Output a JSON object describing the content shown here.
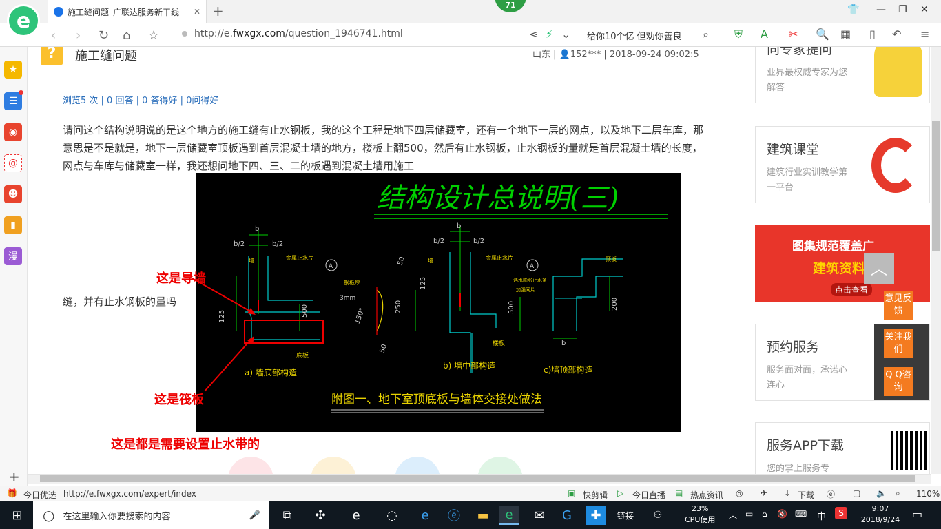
{
  "browser": {
    "tab_title": "施工缝问题_广联达服务新干线",
    "badge": "71",
    "url_prefix": "http://e.",
    "url_domain": "fwxgx.com",
    "url_path": "/question_1946741.html",
    "slogan": "给你10个亿 但劝你善良"
  },
  "sidebar": [
    "star-icon",
    "list-icon",
    "weibo-icon",
    "mail-icon",
    "game-icon",
    "book-icon",
    "comic-icon"
  ],
  "sidebar_comic_label": "漫",
  "question": {
    "title": "施工缝问题",
    "location": "山东",
    "user": "152***",
    "datetime": "2018-09-24 09:02:5",
    "stats": "浏览5 次 | 0 回答 | 0 答得好 | 0问得好",
    "body": "请问这个结构说明说的是这个地方的施工缝有止水钢板，我的这个工程是地下四层储藏室，还有一个地下一层的网点，以及地下二层车库，那意思是不是就是，地下一层储藏室顶板遇到首层混凝土墙的地方，楼板上翻500，然后有止水钢板，止水钢板的量就是首层混凝土墙的长度，网点与车库与储藏室一样，我还想问地下四、三、二的板遇到混凝土墙用施工",
    "body_end": "缝，并有止水钢板的量吗"
  },
  "annotations": {
    "guide_wall": "这是导墙",
    "raft": "这是筏板",
    "note": "这是都是需要设置止水带的"
  },
  "cad": {
    "title": "结构设计总说明(三)",
    "caption": "附图一、地下室顶底板与墙体交接处做法",
    "a_label": "a) 墙底部构造",
    "b_label": "b) 墙中部构造",
    "c_label": "c)墙顶部构造",
    "dims": [
      "b",
      "b/2",
      "b/2",
      "125",
      "500",
      "3mm",
      "50",
      "250",
      "50",
      "125",
      "b",
      "b/2",
      "b/2",
      "500",
      "200",
      "b",
      "150°"
    ],
    "notes": [
      "墙",
      "金属止水片",
      "A",
      "底板",
      "钢板厚",
      "墙",
      "金属止水片",
      "A",
      "楼板",
      "顶板",
      "遇水膨胀止水条",
      "加强网片"
    ]
  },
  "rightcol": {
    "expert_title": "向专家提问",
    "expert_sub": "业界最权威专家为您解答",
    "class_title": "建筑课堂",
    "class_sub": "建筑行业实训教学第一平台",
    "banner_line1": "图集规范覆盖广",
    "banner_line2": "建筑资料数",
    "banner_btn": "点击查看",
    "book_title": "预约服务",
    "book_sub": "服务面对面，承诺心连心",
    "app_title": "服务APP下载",
    "app_sub": "您的掌上服务专"
  },
  "floats": {
    "feedback": "意见反馈",
    "follow": "关注我们",
    "qq": "Q Q咨询"
  },
  "status": {
    "left_label": "今日优选",
    "left_url": "http://e.fwxgx.com/expert/index",
    "items": [
      "快剪辑",
      "今日直播",
      "热点资讯",
      "下载"
    ],
    "zoom": "110%"
  },
  "taskbar": {
    "search_placeholder": "在这里输入你要搜索的内容",
    "links": "链接",
    "cpu_percent": "23%",
    "cpu_label": "CPU使用",
    "ime": "中",
    "time": "9:07",
    "date": "2018/9/24"
  },
  "colors": {
    "accent": "#2ec47a",
    "orange": "#f47b20",
    "cad_green": "#00d000",
    "cad_cyan": "#00cccc",
    "cad_yellow": "#e8d200"
  }
}
